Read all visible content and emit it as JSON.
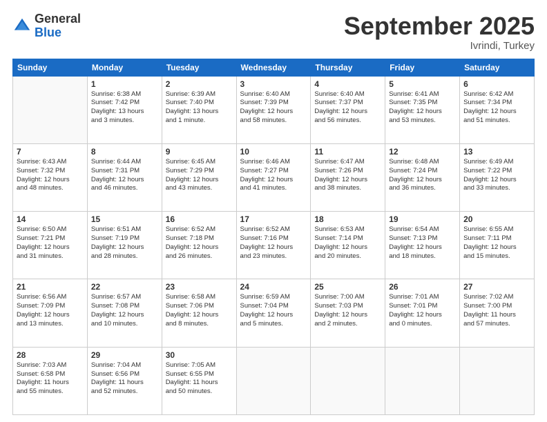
{
  "logo": {
    "general": "General",
    "blue": "Blue"
  },
  "header": {
    "month": "September 2025",
    "location": "Ivrindi, Turkey"
  },
  "weekdays": [
    "Sunday",
    "Monday",
    "Tuesday",
    "Wednesday",
    "Thursday",
    "Friday",
    "Saturday"
  ],
  "weeks": [
    [
      {
        "day": null
      },
      {
        "day": 1,
        "sunrise": "6:38 AM",
        "sunset": "7:42 PM",
        "daylight": "13 hours and 3 minutes."
      },
      {
        "day": 2,
        "sunrise": "6:39 AM",
        "sunset": "7:40 PM",
        "daylight": "13 hours and 1 minute."
      },
      {
        "day": 3,
        "sunrise": "6:40 AM",
        "sunset": "7:39 PM",
        "daylight": "12 hours and 58 minutes."
      },
      {
        "day": 4,
        "sunrise": "6:40 AM",
        "sunset": "7:37 PM",
        "daylight": "12 hours and 56 minutes."
      },
      {
        "day": 5,
        "sunrise": "6:41 AM",
        "sunset": "7:35 PM",
        "daylight": "12 hours and 53 minutes."
      },
      {
        "day": 6,
        "sunrise": "6:42 AM",
        "sunset": "7:34 PM",
        "daylight": "12 hours and 51 minutes."
      }
    ],
    [
      {
        "day": 7,
        "sunrise": "6:43 AM",
        "sunset": "7:32 PM",
        "daylight": "12 hours and 48 minutes."
      },
      {
        "day": 8,
        "sunrise": "6:44 AM",
        "sunset": "7:31 PM",
        "daylight": "12 hours and 46 minutes."
      },
      {
        "day": 9,
        "sunrise": "6:45 AM",
        "sunset": "7:29 PM",
        "daylight": "12 hours and 43 minutes."
      },
      {
        "day": 10,
        "sunrise": "6:46 AM",
        "sunset": "7:27 PM",
        "daylight": "12 hours and 41 minutes."
      },
      {
        "day": 11,
        "sunrise": "6:47 AM",
        "sunset": "7:26 PM",
        "daylight": "12 hours and 38 minutes."
      },
      {
        "day": 12,
        "sunrise": "6:48 AM",
        "sunset": "7:24 PM",
        "daylight": "12 hours and 36 minutes."
      },
      {
        "day": 13,
        "sunrise": "6:49 AM",
        "sunset": "7:22 PM",
        "daylight": "12 hours and 33 minutes."
      }
    ],
    [
      {
        "day": 14,
        "sunrise": "6:50 AM",
        "sunset": "7:21 PM",
        "daylight": "12 hours and 31 minutes."
      },
      {
        "day": 15,
        "sunrise": "6:51 AM",
        "sunset": "7:19 PM",
        "daylight": "12 hours and 28 minutes."
      },
      {
        "day": 16,
        "sunrise": "6:52 AM",
        "sunset": "7:18 PM",
        "daylight": "12 hours and 26 minutes."
      },
      {
        "day": 17,
        "sunrise": "6:52 AM",
        "sunset": "7:16 PM",
        "daylight": "12 hours and 23 minutes."
      },
      {
        "day": 18,
        "sunrise": "6:53 AM",
        "sunset": "7:14 PM",
        "daylight": "12 hours and 20 minutes."
      },
      {
        "day": 19,
        "sunrise": "6:54 AM",
        "sunset": "7:13 PM",
        "daylight": "12 hours and 18 minutes."
      },
      {
        "day": 20,
        "sunrise": "6:55 AM",
        "sunset": "7:11 PM",
        "daylight": "12 hours and 15 minutes."
      }
    ],
    [
      {
        "day": 21,
        "sunrise": "6:56 AM",
        "sunset": "7:09 PM",
        "daylight": "12 hours and 13 minutes."
      },
      {
        "day": 22,
        "sunrise": "6:57 AM",
        "sunset": "7:08 PM",
        "daylight": "12 hours and 10 minutes."
      },
      {
        "day": 23,
        "sunrise": "6:58 AM",
        "sunset": "7:06 PM",
        "daylight": "12 hours and 8 minutes."
      },
      {
        "day": 24,
        "sunrise": "6:59 AM",
        "sunset": "7:04 PM",
        "daylight": "12 hours and 5 minutes."
      },
      {
        "day": 25,
        "sunrise": "7:00 AM",
        "sunset": "7:03 PM",
        "daylight": "12 hours and 2 minutes."
      },
      {
        "day": 26,
        "sunrise": "7:01 AM",
        "sunset": "7:01 PM",
        "daylight": "12 hours and 0 minutes."
      },
      {
        "day": 27,
        "sunrise": "7:02 AM",
        "sunset": "7:00 PM",
        "daylight": "11 hours and 57 minutes."
      }
    ],
    [
      {
        "day": 28,
        "sunrise": "7:03 AM",
        "sunset": "6:58 PM",
        "daylight": "11 hours and 55 minutes."
      },
      {
        "day": 29,
        "sunrise": "7:04 AM",
        "sunset": "6:56 PM",
        "daylight": "11 hours and 52 minutes."
      },
      {
        "day": 30,
        "sunrise": "7:05 AM",
        "sunset": "6:55 PM",
        "daylight": "11 hours and 50 minutes."
      },
      {
        "day": null
      },
      {
        "day": null
      },
      {
        "day": null
      },
      {
        "day": null
      }
    ]
  ]
}
